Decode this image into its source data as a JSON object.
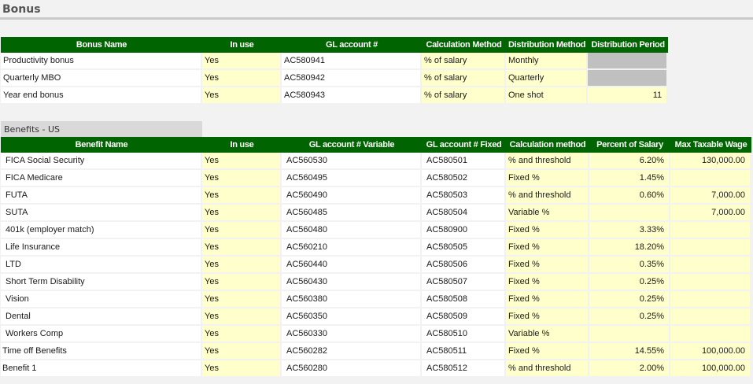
{
  "page": {
    "title": "Bonus"
  },
  "bonus": {
    "columns": [
      "Bonus Name",
      "In use",
      "GL account #",
      "Calculation Method",
      "Distribution Method",
      "Distribution Period"
    ],
    "rows": [
      {
        "name": "Productivity bonus",
        "in_use": "Yes",
        "gl": "AC580941",
        "calc": "% of salary",
        "dist": "Monthly",
        "period": ""
      },
      {
        "name": "Quarterly MBO",
        "in_use": "Yes",
        "gl": "AC580942",
        "calc": "% of salary",
        "dist": "Quarterly",
        "period": ""
      },
      {
        "name": "Year end bonus",
        "in_use": "Yes",
        "gl": "AC580943",
        "calc": "% of salary",
        "dist": "One shot",
        "period": "11"
      }
    ]
  },
  "benefits": {
    "section_title": "Benefits - US",
    "columns": [
      "Benefit Name",
      "In use",
      "GL account # Variable",
      "GL account # Fixed",
      "Calculation method",
      "Percent of Salary",
      "Max Taxable Wage"
    ],
    "rows": [
      {
        "name": "FICA Social Security",
        "in_use": "Yes",
        "gl_var": "AC560530",
        "gl_fixed": "AC580501",
        "calc": "% and threshold",
        "pct": "6.20%",
        "max": "130,000.00"
      },
      {
        "name": "FICA Medicare",
        "in_use": "Yes",
        "gl_var": "AC560495",
        "gl_fixed": "AC580502",
        "calc": "Fixed %",
        "pct": "1.45%",
        "max": ""
      },
      {
        "name": "FUTA",
        "in_use": "Yes",
        "gl_var": "AC560490",
        "gl_fixed": "AC580503",
        "calc": "% and threshold",
        "pct": "0.60%",
        "max": "7,000.00"
      },
      {
        "name": "SUTA",
        "in_use": "Yes",
        "gl_var": "AC560485",
        "gl_fixed": "AC580504",
        "calc": "Variable %",
        "pct": "",
        "max": "7,000.00"
      },
      {
        "name": "401k (employer match)",
        "in_use": "Yes",
        "gl_var": "AC560480",
        "gl_fixed": "AC580900",
        "calc": "Fixed %",
        "pct": "3.33%",
        "max": ""
      },
      {
        "name": "Life Insurance",
        "in_use": "Yes",
        "gl_var": "AC560210",
        "gl_fixed": "AC580505",
        "calc": "Fixed %",
        "pct": "18.20%",
        "max": ""
      },
      {
        "name": "LTD",
        "in_use": "Yes",
        "gl_var": "AC560440",
        "gl_fixed": "AC580506",
        "calc": "Fixed %",
        "pct": "0.35%",
        "max": ""
      },
      {
        "name": "Short Term Disability",
        "in_use": "Yes",
        "gl_var": "AC560430",
        "gl_fixed": "AC580507",
        "calc": "Fixed %",
        "pct": "0.25%",
        "max": ""
      },
      {
        "name": "Vision",
        "in_use": "Yes",
        "gl_var": "AC560380",
        "gl_fixed": "AC580508",
        "calc": "Fixed %",
        "pct": "0.25%",
        "max": ""
      },
      {
        "name": "Dental",
        "in_use": "Yes",
        "gl_var": "AC560350",
        "gl_fixed": "AC580509",
        "calc": "Fixed %",
        "pct": "0.25%",
        "max": ""
      },
      {
        "name": "Workers Comp",
        "in_use": "Yes",
        "gl_var": "AC560330",
        "gl_fixed": "AC580510",
        "calc": "Variable %",
        "pct": "",
        "max": ""
      },
      {
        "name": "Time off Benefits",
        "in_use": "Yes",
        "gl_var": "AC560282",
        "gl_fixed": "AC580511",
        "calc": "Fixed %",
        "pct": "14.55%",
        "max": "100,000.00"
      },
      {
        "name": "Benefit 1",
        "in_use": "Yes",
        "gl_var": "AC560280",
        "gl_fixed": "AC580512",
        "calc": "% and threshold",
        "pct": "2.00%",
        "max": "100,000.00"
      }
    ]
  }
}
